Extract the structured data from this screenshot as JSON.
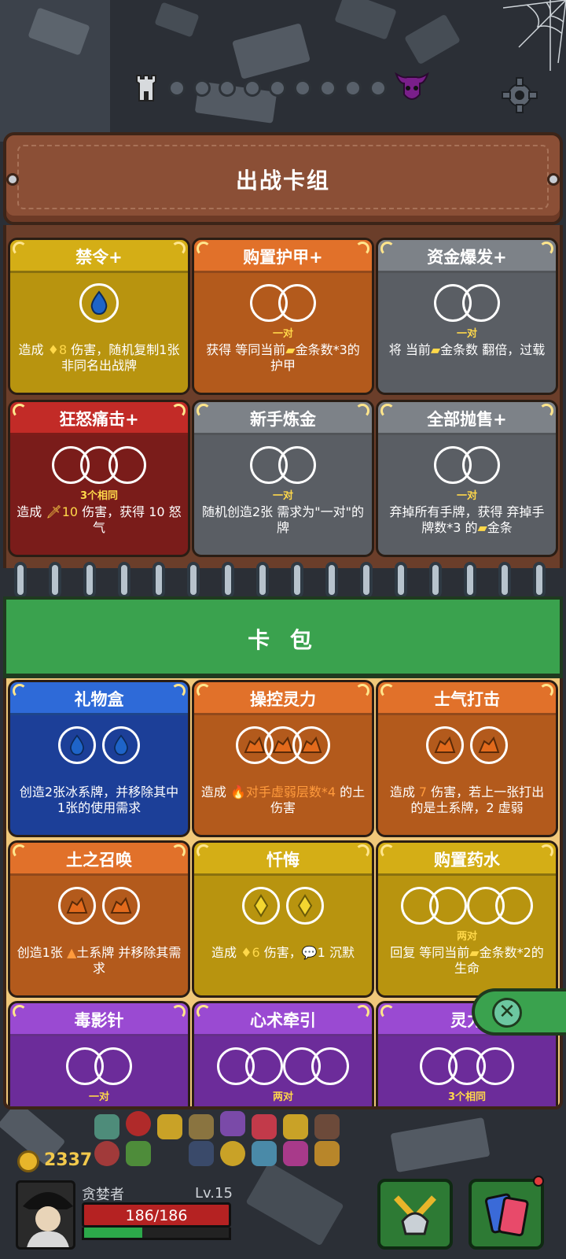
{
  "progress": {
    "dots_total": 9,
    "current_stage": 0
  },
  "deck": {
    "title": "出战卡组",
    "cards": [
      {
        "name": "禁令+",
        "color": "#d4ae16",
        "req_type": "single",
        "req_label": "",
        "desc_pre": "造成 ",
        "desc_hl": "♦8",
        "desc_post": " 伤害，随机复制1张非同名出战牌"
      },
      {
        "name": "购置护甲+",
        "color": "#e1712a",
        "req_type": "pair",
        "req_label": "一对",
        "desc_pre": "获得 等同当前",
        "desc_hl": "▰",
        "desc_post": "金条数*3的护甲"
      },
      {
        "name": "资金爆发+",
        "color": "#7d8288",
        "req_type": "pair",
        "req_label": "一对",
        "desc_pre": "将 当前",
        "desc_hl": "▰",
        "desc_post": "金条数 翻倍，过载"
      },
      {
        "name": "狂怒痛击+",
        "color": "#c22b27",
        "req_type": "triple",
        "req_label": "3个相同",
        "desc_pre": "造成 ",
        "desc_hl": "🗡10",
        "desc_post": " 伤害，获得 10 怒气"
      },
      {
        "name": "新手炼金",
        "color": "#7d8288",
        "req_type": "pair",
        "req_label": "一对",
        "desc_pre": "随机创造2张 需求为\"一对\"的牌",
        "desc_hl": "",
        "desc_post": ""
      },
      {
        "name": "全部抛售+",
        "color": "#7d8288",
        "req_type": "pair",
        "req_label": "一对",
        "desc_pre": "弃掉所有手牌，获得 弃掉手牌数*3 的",
        "desc_hl": "▰",
        "desc_post": "金条"
      }
    ]
  },
  "pack": {
    "title": "卡 包",
    "cards": [
      {
        "name": "礼物盒",
        "color": "#2e6ad8",
        "req_label": "",
        "desc_pre": "创造2张冰系牌，并移除其中1张的使用需求",
        "desc_hl": "",
        "desc_post": ""
      },
      {
        "name": "操控灵力",
        "color": "#e1712a",
        "req_label": "",
        "desc_pre": "造成 ",
        "desc_hl": "🔥对手虚弱层数*4",
        "desc_post": " 的土伤害"
      },
      {
        "name": "士气打击",
        "color": "#e1712a",
        "req_label": "",
        "desc_pre": "造成 ",
        "desc_hl": "7",
        "desc_post": " 伤害，若上一张打出的是土系牌，2 虚弱"
      },
      {
        "name": "土之召唤",
        "color": "#e1712a",
        "req_label": "",
        "desc_pre": "创造1张 ",
        "desc_hl": "▲",
        "desc_post": "土系牌 并移除其需求"
      },
      {
        "name": "忏悔",
        "color": "#d4ae16",
        "req_label": "",
        "desc_pre": "造成 ",
        "desc_hl": "♦6",
        "desc_post": " 伤害，💬1 沉默"
      },
      {
        "name": "购置药水",
        "color": "#d4ae16",
        "req_label": "两对",
        "desc_pre": "回复 等同当前",
        "desc_hl": "▰",
        "desc_post": "金条数*2的生命"
      },
      {
        "name": "毒影针",
        "color": "#9a4ad2",
        "req_label": "一对",
        "desc_pre": "",
        "desc_hl": "",
        "desc_post": ""
      },
      {
        "name": "心术牵引",
        "color": "#9a4ad2",
        "req_label": "两对",
        "desc_pre": "",
        "desc_hl": "",
        "desc_post": ""
      },
      {
        "name": "灵力",
        "color": "#9a4ad2",
        "req_label": "3个相同",
        "desc_pre": "",
        "desc_hl": "",
        "desc_post": ""
      }
    ]
  },
  "hud": {
    "gold": "2337",
    "player_name": "贪婪者",
    "level": "Lv.15",
    "hp": "186/186",
    "xp_fraction": 0.4
  }
}
